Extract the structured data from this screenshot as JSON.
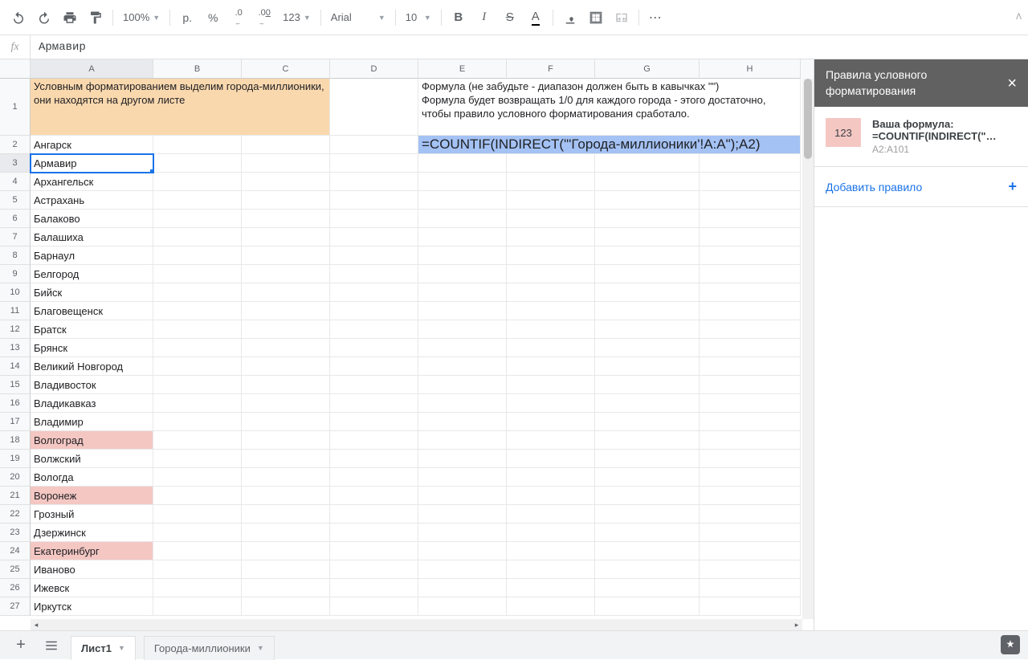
{
  "toolbar": {
    "zoom": "100%",
    "currency": "р.",
    "percent": "%",
    "dec_dec": ".0",
    "inc_dec": ".00",
    "format": "123",
    "font": "Arial",
    "fontsize": "10",
    "text_color_letter": "A"
  },
  "formula_bar": {
    "fx": "fx",
    "value": "Армавир"
  },
  "columns": [
    "A",
    "B",
    "C",
    "D",
    "E",
    "F",
    "G",
    "H"
  ],
  "rows": [
    {
      "n": 1,
      "tall": true,
      "cells": {
        "A": {
          "v": "Условным форматированием выделим города-миллионики, они находятся на другом листе",
          "bg": "orange",
          "span": 3,
          "wrap": true
        },
        "E": {
          "v": "Формула (не забудьте - диапазон должен быть в кавычках \"\")\nФормула будет возвращать 1/0 для каждого города - этого достаточно, чтобы правило условного форматирования сработало.",
          "span": 4,
          "wrap": true
        }
      }
    },
    {
      "n": 2,
      "cells": {
        "A": {
          "v": "Ангарск"
        },
        "E": {
          "v": "=COUNTIF(INDIRECT(\"'Города-миллионики'!A:A\");A2)",
          "bg": "blue",
          "span": 4,
          "big": true
        }
      }
    },
    {
      "n": 3,
      "cells": {
        "A": {
          "v": "Армавир",
          "selected": true
        }
      }
    },
    {
      "n": 4,
      "cells": {
        "A": {
          "v": "Архангельск"
        }
      }
    },
    {
      "n": 5,
      "cells": {
        "A": {
          "v": "Астрахань"
        }
      }
    },
    {
      "n": 6,
      "cells": {
        "A": {
          "v": "Балаково"
        }
      }
    },
    {
      "n": 7,
      "cells": {
        "A": {
          "v": "Балашиха"
        }
      }
    },
    {
      "n": 8,
      "cells": {
        "A": {
          "v": "Барнаул"
        }
      }
    },
    {
      "n": 9,
      "cells": {
        "A": {
          "v": "Белгород"
        }
      }
    },
    {
      "n": 10,
      "cells": {
        "A": {
          "v": "Бийск"
        }
      }
    },
    {
      "n": 11,
      "cells": {
        "A": {
          "v": "Благовещенск"
        }
      }
    },
    {
      "n": 12,
      "cells": {
        "A": {
          "v": "Братск"
        }
      }
    },
    {
      "n": 13,
      "cells": {
        "A": {
          "v": "Брянск"
        }
      }
    },
    {
      "n": 14,
      "cells": {
        "A": {
          "v": "Великий Новгород"
        }
      }
    },
    {
      "n": 15,
      "cells": {
        "A": {
          "v": "Владивосток"
        }
      }
    },
    {
      "n": 16,
      "cells": {
        "A": {
          "v": "Владикавказ"
        }
      }
    },
    {
      "n": 17,
      "cells": {
        "A": {
          "v": "Владимир"
        }
      }
    },
    {
      "n": 18,
      "cells": {
        "A": {
          "v": "Волгоград",
          "bg": "pink"
        }
      }
    },
    {
      "n": 19,
      "cells": {
        "A": {
          "v": "Волжский"
        }
      }
    },
    {
      "n": 20,
      "cells": {
        "A": {
          "v": "Вологда"
        }
      }
    },
    {
      "n": 21,
      "cells": {
        "A": {
          "v": "Воронеж",
          "bg": "pink"
        }
      }
    },
    {
      "n": 22,
      "cells": {
        "A": {
          "v": "Грозный"
        }
      }
    },
    {
      "n": 23,
      "cells": {
        "A": {
          "v": "Дзержинск"
        }
      }
    },
    {
      "n": 24,
      "cells": {
        "A": {
          "v": "Екатеринбург",
          "bg": "pink"
        }
      }
    },
    {
      "n": 25,
      "cells": {
        "A": {
          "v": "Иваново"
        }
      }
    },
    {
      "n": 26,
      "cells": {
        "A": {
          "v": "Ижевск"
        }
      }
    },
    {
      "n": 27,
      "cells": {
        "A": {
          "v": "Иркутск"
        }
      }
    }
  ],
  "sidebar": {
    "title": "Правила условного форматирования",
    "rule": {
      "swatch": "123",
      "line1": "Ваша формула:",
      "line2": "=COUNTIF(INDIRECT(\"…",
      "range": "A2:A101"
    },
    "add_rule": "Добавить правило"
  },
  "tabs": {
    "active": "Лист1",
    "second": "Города-миллионики"
  }
}
